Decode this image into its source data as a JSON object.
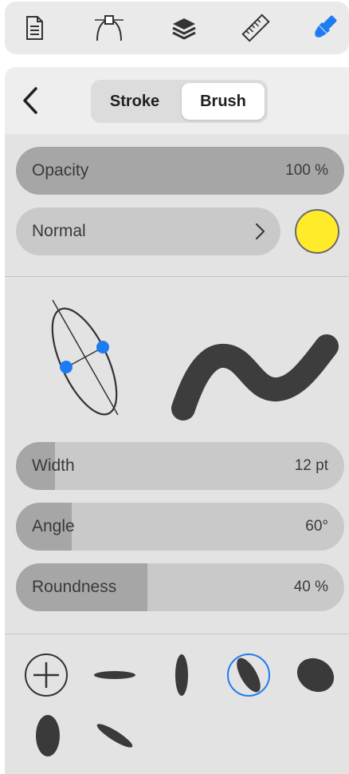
{
  "toolbar": {
    "tools": [
      {
        "name": "document-icon",
        "active": false
      },
      {
        "name": "bezier-pen-icon",
        "active": false
      },
      {
        "name": "layers-icon",
        "active": false
      },
      {
        "name": "ruler-icon",
        "active": false
      },
      {
        "name": "paintbrush-icon",
        "active": true
      }
    ],
    "active_color": "#1e7cf2"
  },
  "panel": {
    "tabs": [
      {
        "label": "Stroke",
        "selected": false
      },
      {
        "label": "Brush",
        "selected": true
      }
    ],
    "opacity": {
      "label": "Opacity",
      "value": "100 %",
      "fraction": 1.0
    },
    "blend_mode": {
      "label": "Normal"
    },
    "color": "#ffeb2a",
    "width": {
      "label": "Width",
      "value": "12 pt",
      "fraction": 0.12
    },
    "angle": {
      "label": "Angle",
      "value": "60°",
      "fraction": 0.17
    },
    "roundness": {
      "label": "Roundness",
      "value": "40 %",
      "fraction": 0.4
    }
  },
  "brush_tips": [
    {
      "name": "add-tip",
      "selected": false
    },
    {
      "name": "flat-horizontal",
      "selected": false
    },
    {
      "name": "narrow-vertical",
      "selected": false
    },
    {
      "name": "tilted-oval",
      "selected": true
    },
    {
      "name": "round-blob",
      "selected": false
    },
    {
      "name": "tall-oval",
      "selected": false
    },
    {
      "name": "thin-diagonal",
      "selected": false
    }
  ]
}
